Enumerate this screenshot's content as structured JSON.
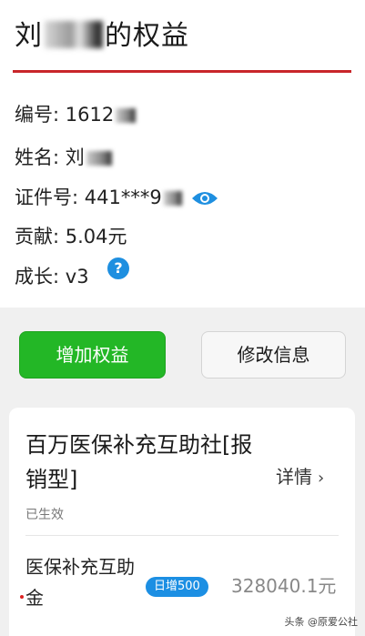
{
  "header": {
    "title_prefix": "刘",
    "title_suffix": "的权益"
  },
  "info": {
    "member_no_label": "编号:",
    "member_no_value": "1612",
    "name_label": "姓名:",
    "name_value": "刘",
    "id_label": "证件号:",
    "id_value": "441***9",
    "contribution_label": "贡献:",
    "contribution_value": "5.04元",
    "growth_label": "成长:",
    "growth_value": "v3",
    "help_glyph": "?"
  },
  "actions": {
    "add_label": "增加权益",
    "edit_label": "修改信息"
  },
  "plan": {
    "title": "百万医保补充互助社[报销型]",
    "status": "已生效",
    "details_label": "详情",
    "details_chevron": "›",
    "fund_label": "医保补充互助金",
    "daily_badge": "日增500",
    "fund_amount": "328040.1元"
  },
  "watermark": "头条 @原爱公社",
  "colors": {
    "accent_red": "#c8262a",
    "primary_green": "#23b726",
    "badge_blue": "#1c8fe3"
  },
  "icons": [
    "eye-icon",
    "help-icon",
    "chevron-right-icon"
  ]
}
